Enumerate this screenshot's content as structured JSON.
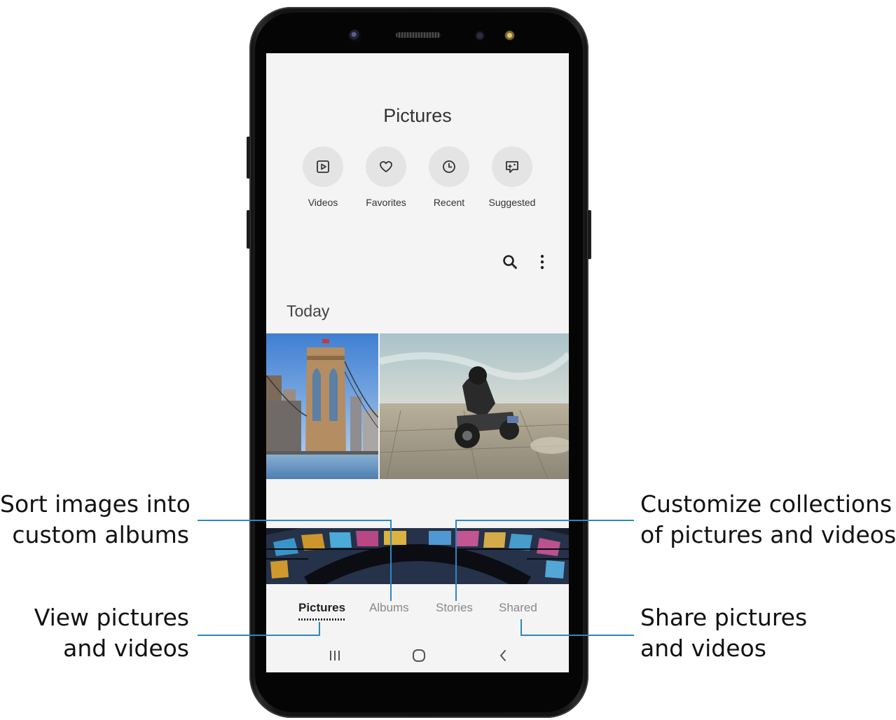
{
  "gallery": {
    "title": "Pictures",
    "quick_actions": [
      {
        "label": "Videos",
        "icon": "play-icon"
      },
      {
        "label": "Favorites",
        "icon": "heart-icon"
      },
      {
        "label": "Recent",
        "icon": "clock-icon"
      },
      {
        "label": "Suggested",
        "icon": "sparkle-chat-icon"
      }
    ],
    "toolbar": {
      "search_icon": "search-icon",
      "more_icon": "more-vertical-icon"
    },
    "section_header": "Today",
    "photos": [
      {
        "subject": "bridge-photo"
      },
      {
        "subject": "motorcycle-photo"
      },
      {
        "subject": "glass-dome-photo"
      }
    ],
    "tabs": [
      {
        "label": "Pictures",
        "active": true
      },
      {
        "label": "Albums",
        "active": false
      },
      {
        "label": "Stories",
        "active": false
      },
      {
        "label": "Shared",
        "active": false
      }
    ],
    "system_nav": [
      "recents-icon",
      "home-icon",
      "back-icon"
    ]
  },
  "callouts": {
    "albums": {
      "line1": "Sort images into",
      "line2": "custom albums"
    },
    "pictures": {
      "line1": "View pictures",
      "line2": "and videos"
    },
    "stories": {
      "line1": "Customize collections",
      "line2": "of pictures and videos"
    },
    "shared": {
      "line1": "Share pictures",
      "line2": "and videos"
    }
  },
  "colors": {
    "leader_line": "#2a89c0",
    "screen_background": "#f4f4f4",
    "phone_body": "#111111",
    "active_tab_text": "#222222",
    "inactive_tab_text": "#888888"
  }
}
